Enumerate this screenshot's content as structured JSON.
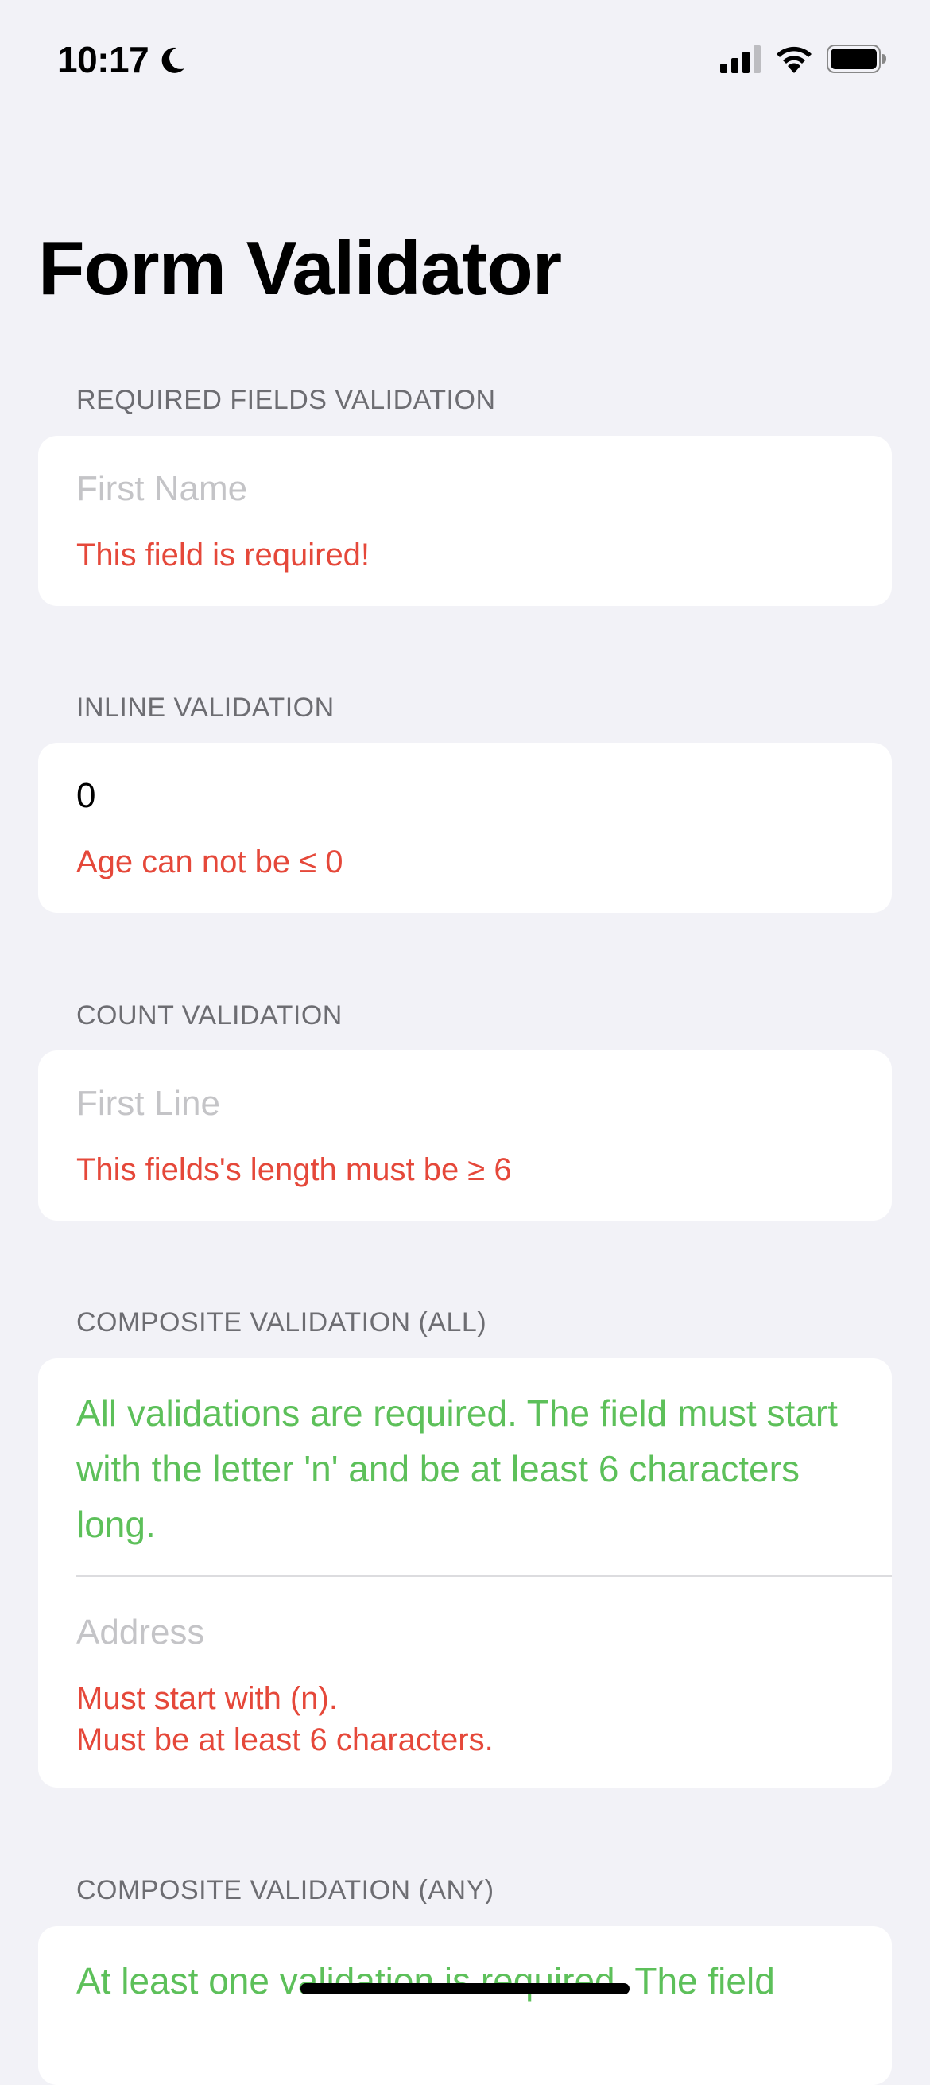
{
  "status_bar": {
    "time": "10:17"
  },
  "title": "Form Validator",
  "sections": {
    "required": {
      "header": "REQUIRED FIELDS VALIDATION",
      "placeholder": "First Name",
      "error": "This field is required!"
    },
    "inline": {
      "header": "INLINE VALIDATION",
      "value": "0",
      "error": "Age can not be ≤ 0"
    },
    "count": {
      "header": "COUNT VALIDATION",
      "placeholder": "First Line",
      "error": "This fields's length must be ≥ 6"
    },
    "composite_all": {
      "header": "COMPOSITE VALIDATION (ALL)",
      "info": "All validations are required. The field must start with the letter 'n' and be at least 6 characters long.",
      "placeholder": "Address",
      "error_1": "Must start with (n).",
      "error_2": "Must be at least 6 characters."
    },
    "composite_any": {
      "header": "COMPOSITE VALIDATION (ANY)",
      "info": "At least one validation is required. The field"
    }
  },
  "colors": {
    "background": "#F2F2F7",
    "error": "#E5483A",
    "success": "#5DC05A",
    "placeholder": "#C4C4C7"
  },
  "icons": [
    "moon-icon",
    "cellular-signal-icon",
    "wifi-icon",
    "battery-icon"
  ]
}
